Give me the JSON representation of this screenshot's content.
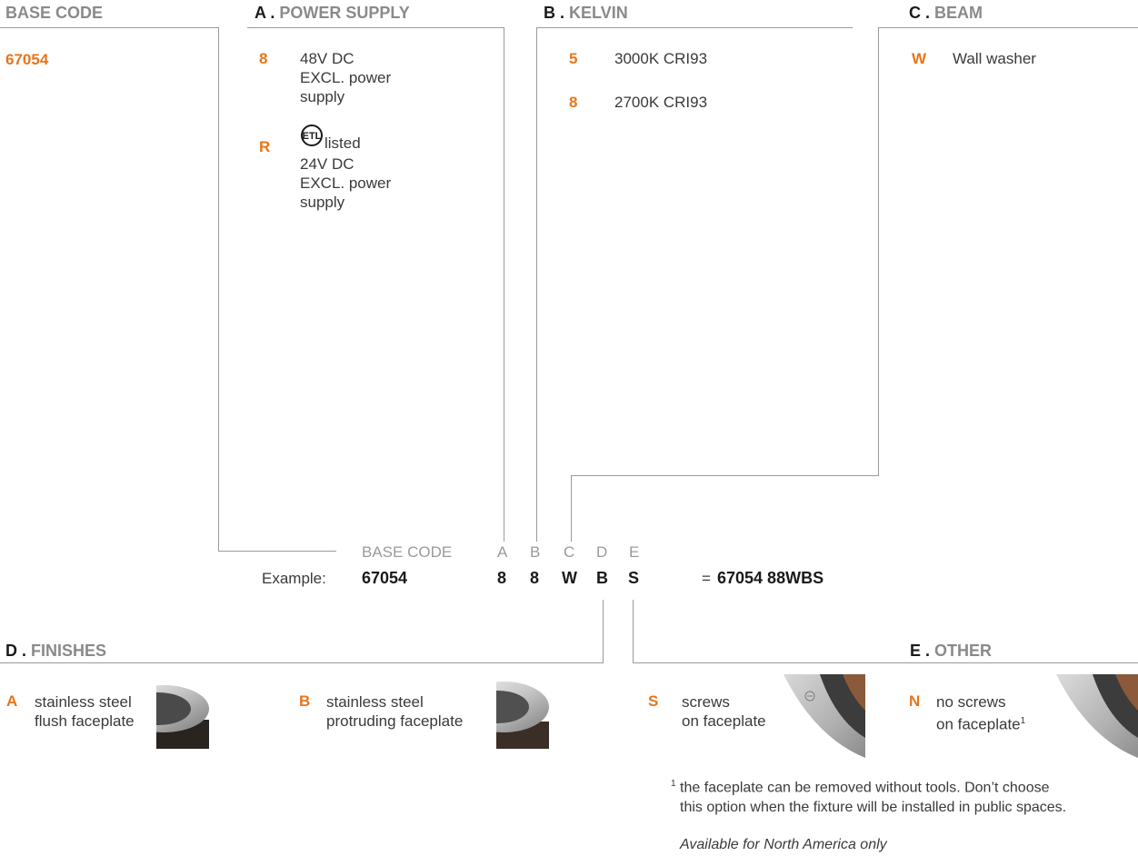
{
  "headers": {
    "base": {
      "letter": "",
      "label": "BASE CODE"
    },
    "a": {
      "letter": "A .",
      "label": "POWER SUPPLY"
    },
    "b": {
      "letter": "B .",
      "label": "KELVIN"
    },
    "c": {
      "letter": "C .",
      "label": "BEAM"
    },
    "d": {
      "letter": "D .",
      "label": "FINISHES"
    },
    "e": {
      "letter": "E .",
      "label": "OTHER"
    }
  },
  "base_code": "67054",
  "power_supply": [
    {
      "code": "8",
      "lines": [
        "48V DC",
        "EXCL. power",
        "supply"
      ]
    },
    {
      "code": "R",
      "listed": "listed",
      "lines": [
        "24V DC",
        "EXCL. power",
        "supply"
      ],
      "badge": "ETL"
    }
  ],
  "kelvin": [
    {
      "code": "5",
      "label": "3000K CRI93"
    },
    {
      "code": "8",
      "label": "2700K CRI93"
    }
  ],
  "beam": [
    {
      "code": "W",
      "label": "Wall washer"
    }
  ],
  "example": {
    "labels": [
      "BASE CODE",
      "A",
      "B",
      "C",
      "D",
      "E"
    ],
    "prefix": "Example:",
    "base": "67054",
    "values": [
      "8",
      "8",
      "W",
      "B",
      "S"
    ],
    "equals": "=",
    "result": "67054 88WBS"
  },
  "finishes": [
    {
      "code": "A",
      "line1": "stainless steel",
      "line2": "flush faceplate"
    },
    {
      "code": "B",
      "line1": "stainless steel",
      "line2": "protruding faceplate"
    }
  ],
  "other": [
    {
      "code": "S",
      "line1": "screws",
      "line2": "on faceplate",
      "sup": ""
    },
    {
      "code": "N",
      "line1": "no screws",
      "line2": "on faceplate",
      "sup": "1"
    }
  ],
  "footnote": {
    "mark": "1",
    "line1": "the faceplate can be removed without tools. Don’t choose",
    "line2": "this option when the fixture will be installed in public spaces.",
    "availability": "Available for North America only"
  },
  "colors": {
    "accent": "#e8751a",
    "line": "#9a9a9a",
    "header": "#8a8a8a"
  }
}
